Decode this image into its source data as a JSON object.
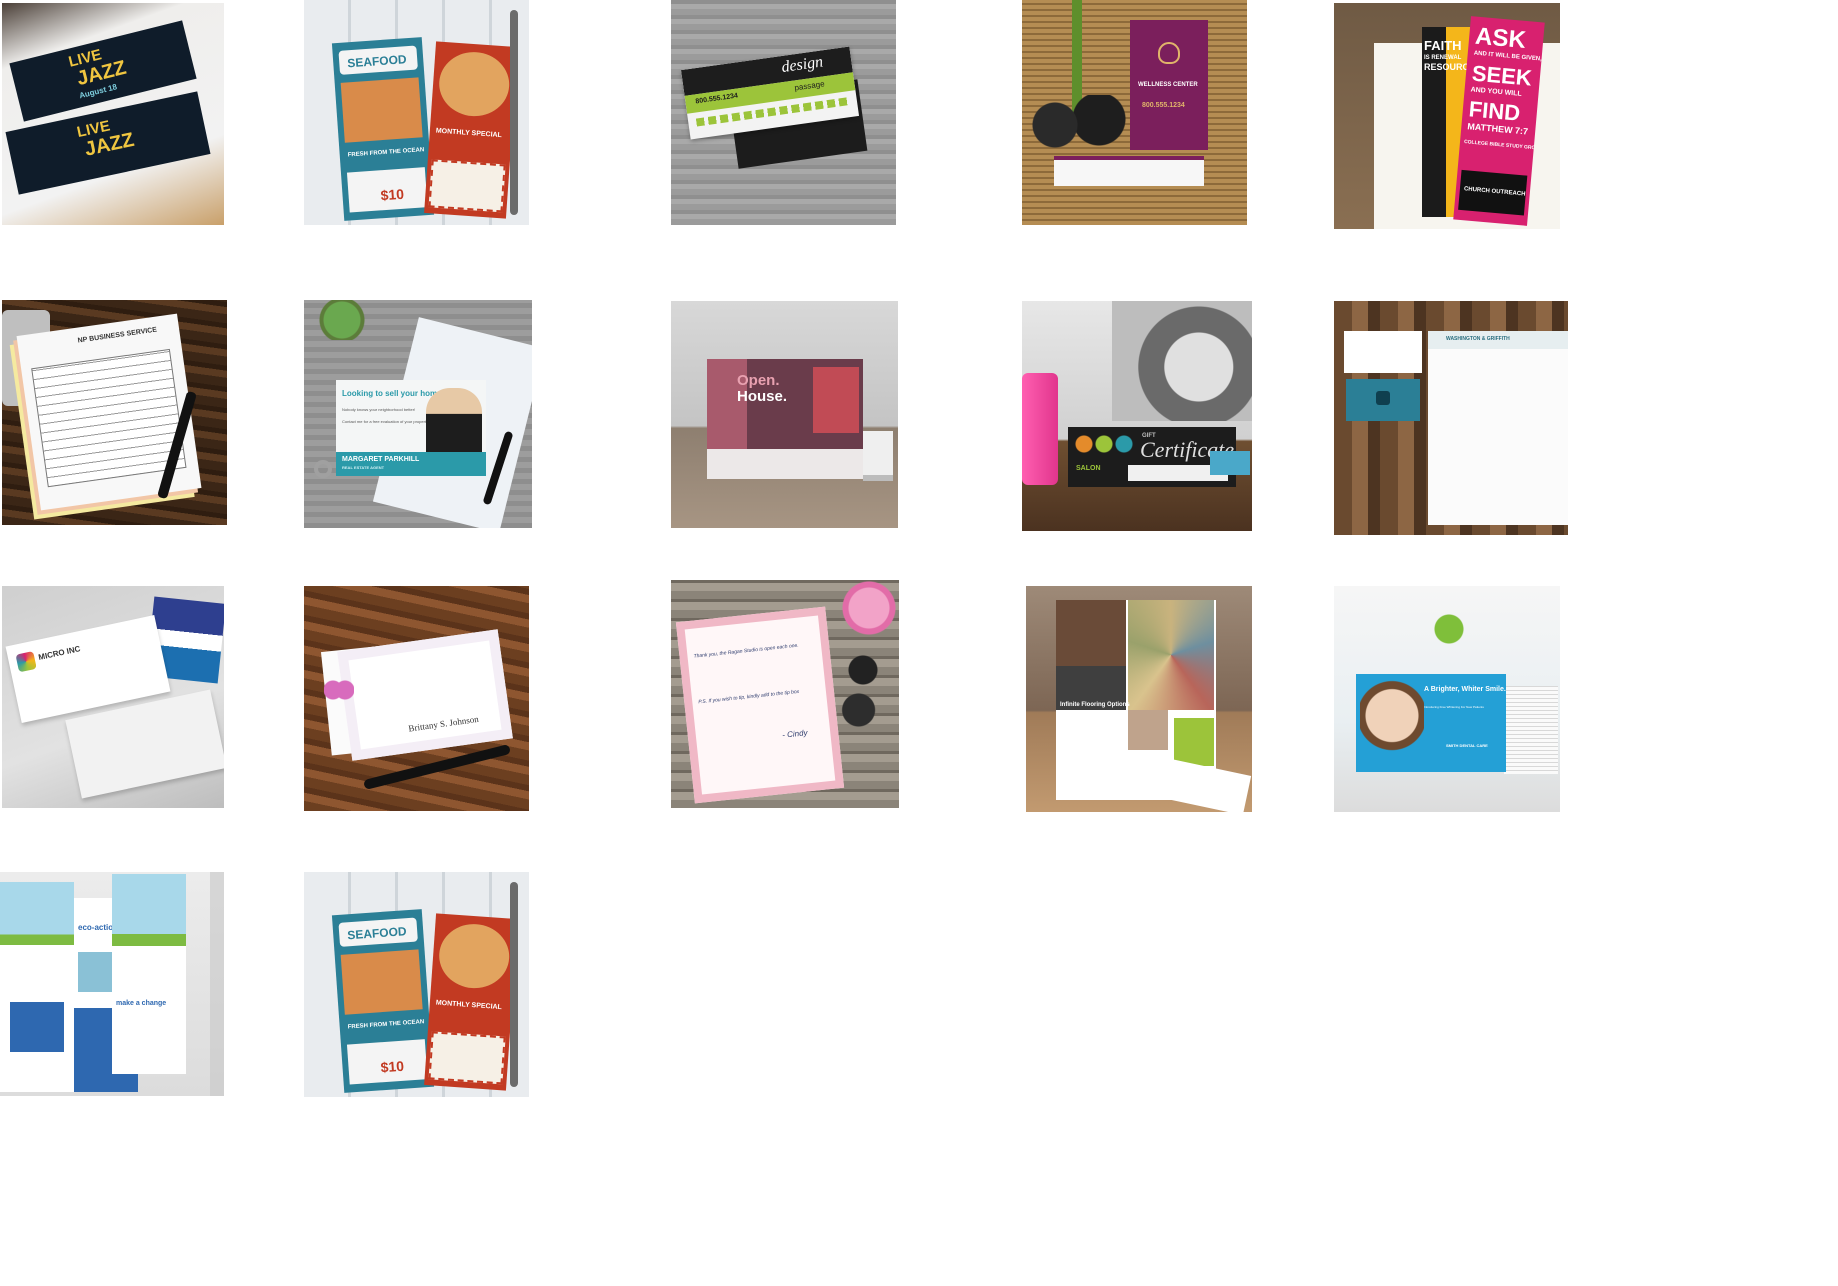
{
  "gallery": {
    "items": [
      {
        "name": "event-tickets",
        "texts": [
          "LIVE",
          "JAZZ",
          "August 18"
        ]
      },
      {
        "name": "rack-cards",
        "texts": [
          "SEAFOOD",
          "MONTHLY SPECIAL",
          "FRESH FROM THE OCEAN",
          "$10"
        ]
      },
      {
        "name": "business-cards",
        "texts": [
          "design",
          "passage",
          "800.555.1234"
        ]
      },
      {
        "name": "appointment-cards",
        "texts": [
          "WELLNESS CENTER",
          "800.555.1234"
        ]
      },
      {
        "name": "bookmarks",
        "texts": [
          "FAITH",
          "IS RENEWAL",
          "RESOURCE",
          "ASK",
          "AND IT WILL BE GIVEN,",
          "SEEK",
          "AND YOU WILL",
          "FIND",
          "MATTHEW 7:7",
          "COLLEGE BIBLE STUDY GROUP",
          "CHURCH OUTREACH"
        ]
      },
      {
        "name": "carbonless-forms",
        "texts": [
          "NP BUSINESS SERVICE"
        ]
      },
      {
        "name": "postcards-real-estate",
        "texts": [
          "Looking to sell your home?",
          "Nobody knows your neighborhood better!",
          "Contact me for a free evaluation of your property.",
          "MARGARET PARKHILL",
          "REAL ESTATE AGENT"
        ]
      },
      {
        "name": "tent-cards",
        "texts": [
          "Open.",
          "House."
        ]
      },
      {
        "name": "gift-certificates",
        "texts": [
          "GIFT",
          "Certificate",
          "SALON"
        ]
      },
      {
        "name": "letterhead",
        "texts": [
          "WASHINGTON & GRIFFITH"
        ]
      },
      {
        "name": "envelopes",
        "texts": [
          "MICRO INC"
        ]
      },
      {
        "name": "note-cards",
        "texts": [
          "Brittany S. Johnson"
        ]
      },
      {
        "name": "notepads",
        "texts": [
          "Thank you, the Ragan Studio is open each one.",
          "P.S. If you wish to tip, kindly add to the tip box",
          "- Cindy"
        ]
      },
      {
        "name": "presentation-folders",
        "texts": [
          "Infinite Flooring Options"
        ]
      },
      {
        "name": "postcards-dental",
        "texts": [
          "A Brighter, Whiter Smile.",
          "Introducing Free Whitening For New Patients",
          "SMITH DENTAL CARE"
        ]
      },
      {
        "name": "brochures",
        "texts": [
          "eco-action",
          "make a change"
        ]
      },
      {
        "name": "rack-cards-repeat",
        "texts": [
          "SEAFOOD",
          "MONTHLY SPECIAL",
          "FRESH FROM THE OCEAN",
          "$10"
        ]
      }
    ]
  },
  "colors": {
    "teal": "#2b7f96",
    "red": "#c23a22",
    "lime": "#9cc43a",
    "purple": "#7b1f5c",
    "magenta": "#d8216f",
    "rose": "#a85a6c",
    "dental_blue": "#24a0d6"
  }
}
